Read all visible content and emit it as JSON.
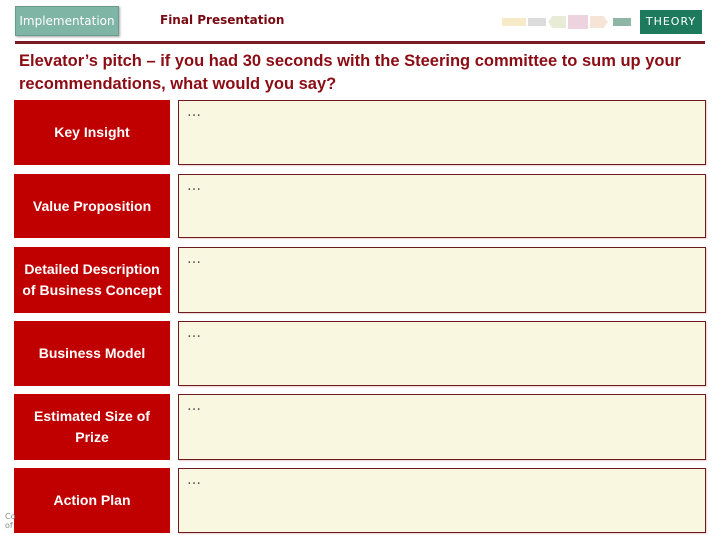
{
  "header": {
    "phase_tab": "Implementation",
    "subtitle": "Final Presentation",
    "badge": "THEORY",
    "process_flow_steps": [
      "step-1",
      "step-2",
      "step-3",
      "step-4",
      "step-5",
      "step-6"
    ]
  },
  "heading": "Elevator’s pitch – if you had 30 seconds with the Steering committee to sum up your recommendations, what would you say?",
  "rows": [
    {
      "label": "Key Insight",
      "value": "…"
    },
    {
      "label": "Value Proposition",
      "value": "…"
    },
    {
      "label": "Detailed Description of Business Concept",
      "value": "…"
    },
    {
      "label": "Business Model",
      "value": "…"
    },
    {
      "label": "Estimated Size of Prize",
      "value": "…"
    },
    {
      "label": "Action Plan",
      "value": "…"
    }
  ],
  "footer_fragment": "Co\nof",
  "colors": {
    "accent_red": "#c00000",
    "heading_red": "#8b0c14",
    "theory_green": "#1e7a5c",
    "implementation_tab": "#7fb5a4",
    "content_fill": "#faf7e1"
  }
}
